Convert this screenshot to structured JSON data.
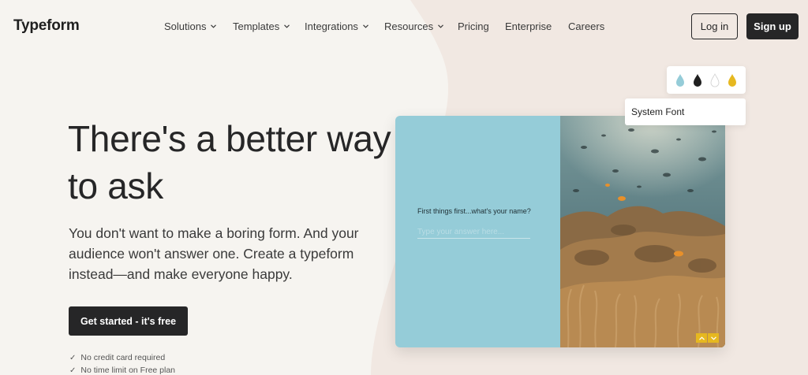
{
  "brand": {
    "name": "Typeform"
  },
  "nav": {
    "items": [
      {
        "label": "Solutions",
        "dropdown": true
      },
      {
        "label": "Templates",
        "dropdown": true
      },
      {
        "label": "Integrations",
        "dropdown": true
      },
      {
        "label": "Resources",
        "dropdown": true
      },
      {
        "label": "Pricing",
        "dropdown": false
      },
      {
        "label": "Enterprise",
        "dropdown": false
      },
      {
        "label": "Careers",
        "dropdown": false
      }
    ],
    "login_label": "Log in",
    "signup_label": "Sign up"
  },
  "hero": {
    "title": "There's a better way to ask",
    "subtitle": "You don't want to make a boring form. And your audience won't answer one. Create a typeform instead—and make everyone happy.",
    "cta_label": "Get started - it's free",
    "checks": [
      {
        "icon": "check-icon",
        "label": "No credit card required"
      },
      {
        "icon": "check-icon",
        "label": "No time limit on Free plan"
      }
    ]
  },
  "preview": {
    "question": "First things first...what's your name?",
    "input_placeholder": "Type your answer here...",
    "font_label": "System Font",
    "swatches": [
      {
        "name": "teal-drop-icon",
        "color": "#95ccd8"
      },
      {
        "name": "black-drop-icon",
        "color": "#1f1f1f"
      },
      {
        "name": "white-drop-icon",
        "color": "#ffffff"
      },
      {
        "name": "yellow-drop-icon",
        "color": "#e6b820"
      }
    ],
    "arrows": [
      {
        "name": "chevron-up-icon"
      },
      {
        "name": "chevron-down-icon"
      }
    ]
  },
  "colors": {
    "background": "#f6f4f0",
    "blob": "#efe6df",
    "dark": "#262627",
    "card_left": "#95ccd8",
    "accent_yellow": "#e6b820"
  }
}
